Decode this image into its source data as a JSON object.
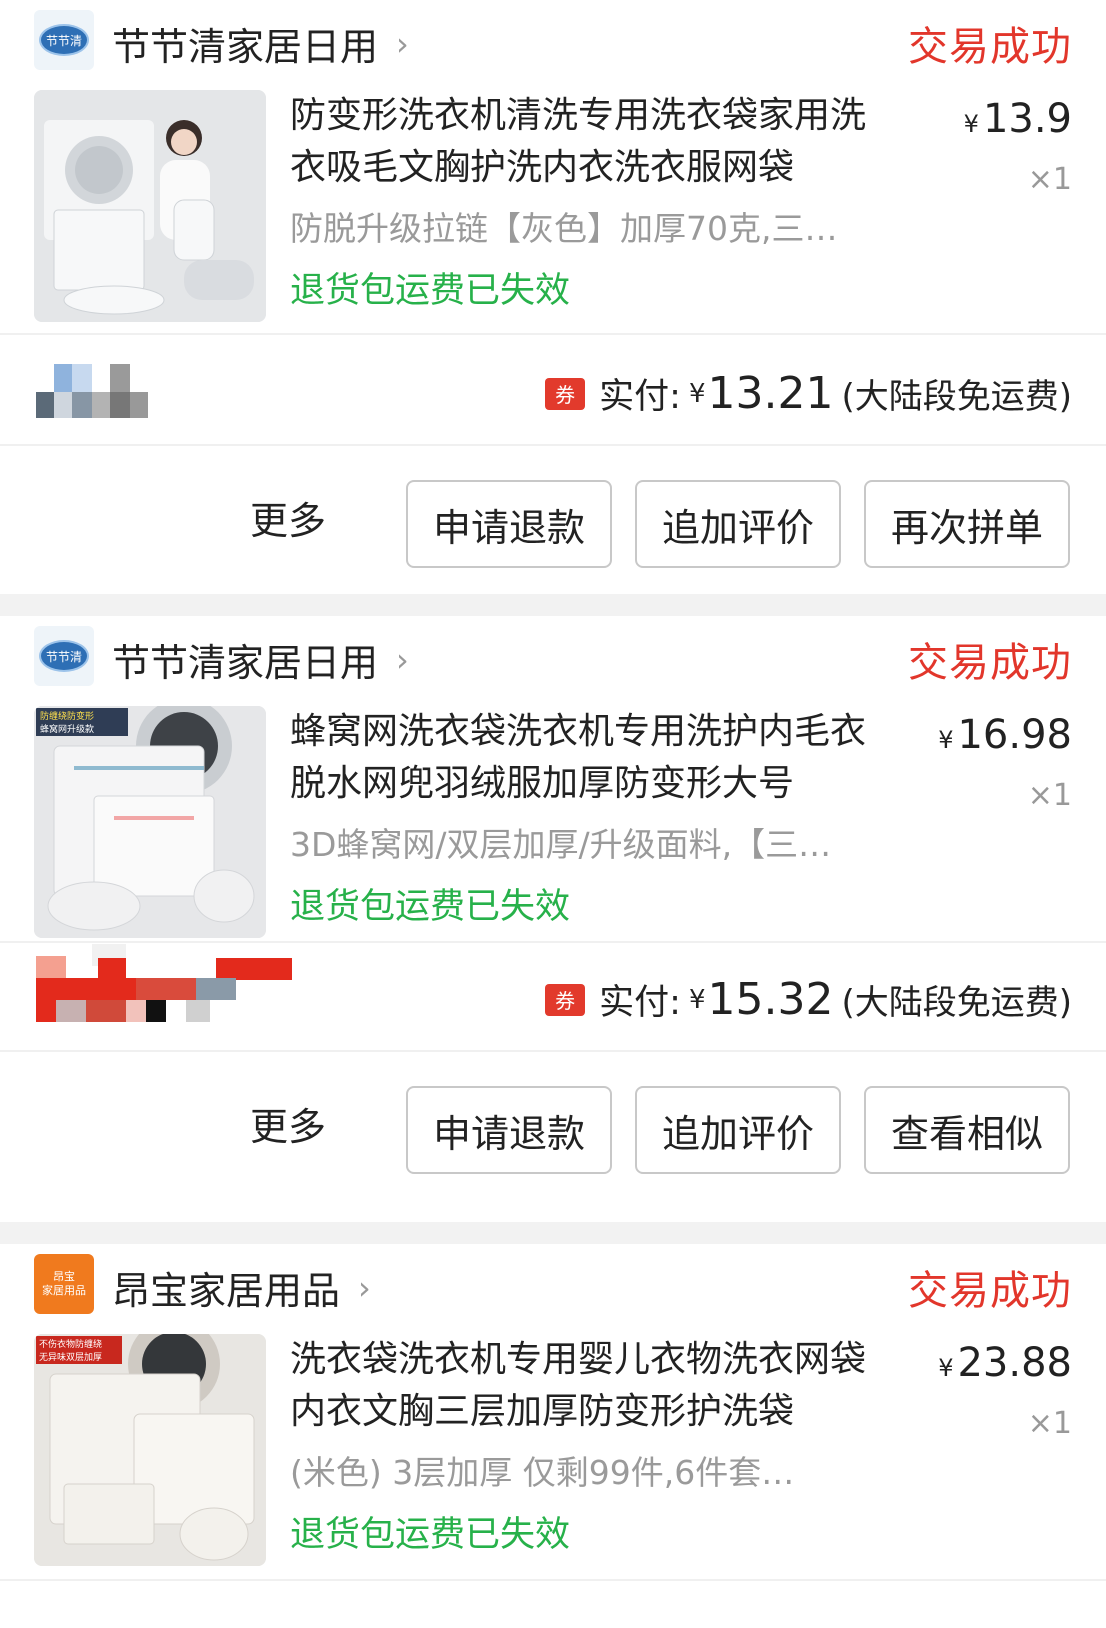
{
  "orders": [
    {
      "shop_name": "节节清家居日用",
      "shop_logo_text": "节节清",
      "status": "交易成功",
      "product": {
        "title": "防变形洗衣机清洗专用洗衣袋家用洗衣吸毛文胸护洗内衣洗衣服网袋",
        "sku": "防脱升级拉链【灰色】加厚70克,三…",
        "refund_note": "退货包运费已失效",
        "price_currency": "¥",
        "price": "13.9",
        "quantity": "×1"
      },
      "payment": {
        "coupon_badge": "券",
        "label": "实付:",
        "currency": "¥",
        "amount": "13.21",
        "note": "(大陆段免运费)"
      },
      "actions": {
        "more": "更多",
        "buttons": [
          "申请退款",
          "追加评价",
          "再次拼单"
        ]
      }
    },
    {
      "shop_name": "节节清家居日用",
      "shop_logo_text": "节节清",
      "status": "交易成功",
      "product": {
        "title": "蜂窝网洗衣袋洗衣机专用洗护内毛衣脱水网兜羽绒服加厚防变形大号",
        "sku": "3D蜂窝网/双层加厚/升级面料,【三…",
        "refund_note": "退货包运费已失效",
        "price_currency": "¥",
        "price": "16.98",
        "quantity": "×1",
        "image_caption": [
          "防缠绕防变形",
          "蜂窝网升级款"
        ]
      },
      "payment": {
        "coupon_badge": "券",
        "label": "实付:",
        "currency": "¥",
        "amount": "15.32",
        "note": "(大陆段免运费)"
      },
      "actions": {
        "more": "更多",
        "buttons": [
          "申请退款",
          "追加评价",
          "查看相似"
        ]
      }
    },
    {
      "shop_name": "昂宝家居用品",
      "shop_logo_text": [
        "昂宝",
        "家居用品"
      ],
      "status": "交易成功",
      "product": {
        "title": "洗衣袋洗衣机专用婴儿衣物洗衣网袋内衣文胸三层加厚防变形护洗袋",
        "sku": "(米色) 3层加厚 仅剩99件,6件套…",
        "refund_note": "退货包运费已失效",
        "price_currency": "¥",
        "price": "23.88",
        "quantity": "×1",
        "image_caption": [
          "不伤衣物防缠绕",
          "无异味双层加厚"
        ]
      }
    }
  ],
  "colors": {
    "status_red": "#e2362b",
    "refund_green": "#27b14a",
    "coupon_red": "#e23a2c",
    "logo_orange": "#f07a1e",
    "logo_blue": "#2e6fb5"
  },
  "icons": {
    "chevron": "chevron-right-icon",
    "coupon": "coupon-badge-icon"
  }
}
